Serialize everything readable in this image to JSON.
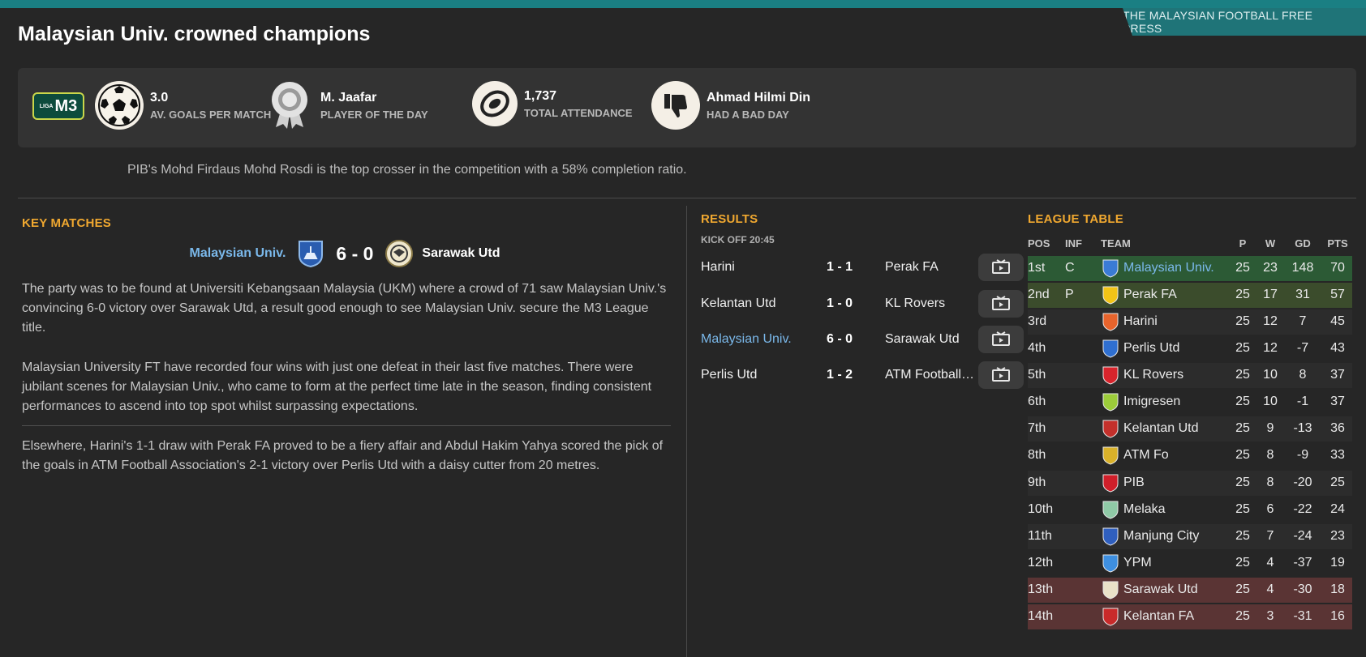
{
  "press_name": "THE MALAYSIAN FOOTBALL FREE PRESS",
  "headline": "Malaysian Univ. crowned champions",
  "league_badge": {
    "prefix": "LIGA",
    "name": "M3"
  },
  "stats": [
    {
      "value": "3.0",
      "label": "AV. GOALS PER MATCH",
      "icon": "football-icon"
    },
    {
      "value": "M. Jaafar",
      "label": "PLAYER OF THE DAY",
      "icon": "award-medal-icon"
    },
    {
      "value": "1,737",
      "label": "TOTAL ATTENDANCE",
      "icon": "stadium-icon"
    },
    {
      "value": "Ahmad Hilmi Din",
      "label": "HAD A BAD DAY",
      "icon": "thumbs-down-icon"
    }
  ],
  "tip": "PIB's Mohd Firdaus Mohd Rosdi is the top crosser in the competition with a 58% completion ratio.",
  "key_matches": {
    "title": "KEY MATCHES",
    "home": "Malaysian Univ.",
    "score": "6 - 0",
    "away": "Sarawak Utd",
    "paragraphs": [
      "The party was to be found at Universiti Kebangsaan Malaysia (UKM) where a crowd of 71 saw Malaysian Univ.'s convincing 6-0 victory over Sarawak Utd, a result good enough to see Malaysian Univ. secure the M3 League title.",
      "Malaysian University FT have recorded four wins with just one defeat in their last five matches. There were jubilant scenes for Malaysian Univ., who came to form at the perfect time late in the season, finding consistent performances to ascend into top spot whilst surpassing expectations.",
      "Elsewhere, Harini's 1-1 draw with Perak FA proved to be a fiery affair and Abdul Hakim Yahya scored the pick of the goals in ATM Football Association's 2-1 victory over Perlis Utd with a daisy cutter from 20 metres."
    ]
  },
  "results": {
    "title": "RESULTS",
    "kickoff": "KICK OFF 20:45",
    "matches": [
      {
        "home": "Harini",
        "score": "1 - 1",
        "away": "Perak FA"
      },
      {
        "home": "Kelantan Utd",
        "score": "1 - 0",
        "away": "KL Rovers"
      },
      {
        "home": "Malaysian Univ.",
        "score": "6 - 0",
        "away": "Sarawak Utd"
      },
      {
        "home": "Perlis Utd",
        "score": "1 - 2",
        "away": "ATM Football Association"
      }
    ]
  },
  "league_table": {
    "title": "LEAGUE TABLE",
    "headers": {
      "pos": "POS",
      "inf": "INF",
      "team": "TEAM",
      "p": "P",
      "w": "W",
      "gd": "GD",
      "pts": "PTS"
    },
    "rows": [
      {
        "pos": "1st",
        "inf": "C",
        "team": "Malaysian Univ.",
        "p": "25",
        "w": "23",
        "gd": "148",
        "pts": "70",
        "crest": "#3a7bd5"
      },
      {
        "pos": "2nd",
        "inf": "P",
        "team": "Perak FA",
        "p": "25",
        "w": "17",
        "gd": "31",
        "pts": "57",
        "crest": "#f2c417"
      },
      {
        "pos": "3rd",
        "inf": "",
        "team": "Harini",
        "p": "25",
        "w": "12",
        "gd": "7",
        "pts": "45",
        "crest": "#e8642c"
      },
      {
        "pos": "4th",
        "inf": "",
        "team": "Perlis Utd",
        "p": "25",
        "w": "12",
        "gd": "-7",
        "pts": "43",
        "crest": "#2f6fd0"
      },
      {
        "pos": "5th",
        "inf": "",
        "team": "KL Rovers",
        "p": "25",
        "w": "10",
        "gd": "8",
        "pts": "37",
        "crest": "#d8242c"
      },
      {
        "pos": "6th",
        "inf": "",
        "team": "Imigresen",
        "p": "25",
        "w": "10",
        "gd": "-1",
        "pts": "37",
        "crest": "#9ccc3a"
      },
      {
        "pos": "7th",
        "inf": "",
        "team": "Kelantan Utd",
        "p": "25",
        "w": "9",
        "gd": "-13",
        "pts": "36",
        "crest": "#c4302b"
      },
      {
        "pos": "8th",
        "inf": "",
        "team": "ATM Fo",
        "p": "25",
        "w": "8",
        "gd": "-9",
        "pts": "33",
        "crest": "#d9b12a"
      },
      {
        "pos": "9th",
        "inf": "",
        "team": "PIB",
        "p": "25",
        "w": "8",
        "gd": "-20",
        "pts": "25",
        "crest": "#d01f2a"
      },
      {
        "pos": "10th",
        "inf": "",
        "team": "Melaka",
        "p": "25",
        "w": "6",
        "gd": "-22",
        "pts": "24",
        "crest": "#8fc9a6"
      },
      {
        "pos": "11th",
        "inf": "",
        "team": "Manjung City",
        "p": "25",
        "w": "7",
        "gd": "-24",
        "pts": "23",
        "crest": "#2f5fbf"
      },
      {
        "pos": "12th",
        "inf": "",
        "team": "YPM",
        "p": "25",
        "w": "4",
        "gd": "-37",
        "pts": "19",
        "crest": "#3e8fe0"
      },
      {
        "pos": "13th",
        "inf": "",
        "team": "Sarawak Utd",
        "p": "25",
        "w": "4",
        "gd": "-30",
        "pts": "18",
        "crest": "#e9e2c8"
      },
      {
        "pos": "14th",
        "inf": "",
        "team": "Kelantan FA",
        "p": "25",
        "w": "3",
        "gd": "-31",
        "pts": "16",
        "crest": "#c92a2a"
      }
    ]
  }
}
